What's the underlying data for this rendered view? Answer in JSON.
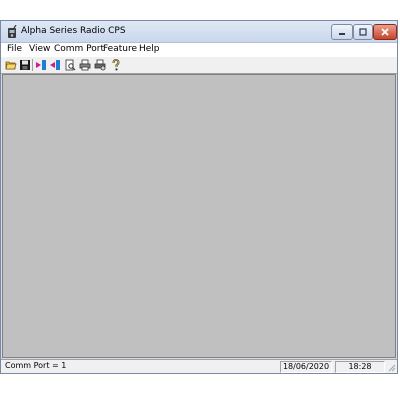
{
  "window": {
    "title": "Alpha Series Radio CPS"
  },
  "menu": {
    "items": [
      {
        "label": "File"
      },
      {
        "label": "View"
      },
      {
        "label": "Comm Port"
      },
      {
        "label": "Feature"
      },
      {
        "label": "Help"
      }
    ]
  },
  "toolbar": {
    "buttons": [
      {
        "icon": "open-folder-icon"
      },
      {
        "icon": "save-disk-icon"
      },
      {
        "icon": "read-from-radio-icon"
      },
      {
        "icon": "write-to-radio-icon"
      },
      {
        "icon": "print-preview-icon"
      },
      {
        "icon": "print-icon"
      },
      {
        "icon": "print-setup-icon"
      },
      {
        "icon": "help-icon"
      }
    ]
  },
  "status": {
    "comm_port": "Comm Port = 1",
    "date": "18/06/2020",
    "time": "18:28"
  },
  "colors": {
    "client_area": "#c0c0c0",
    "title_bar": "#dfe8f5",
    "close_button": "#c9432b"
  }
}
